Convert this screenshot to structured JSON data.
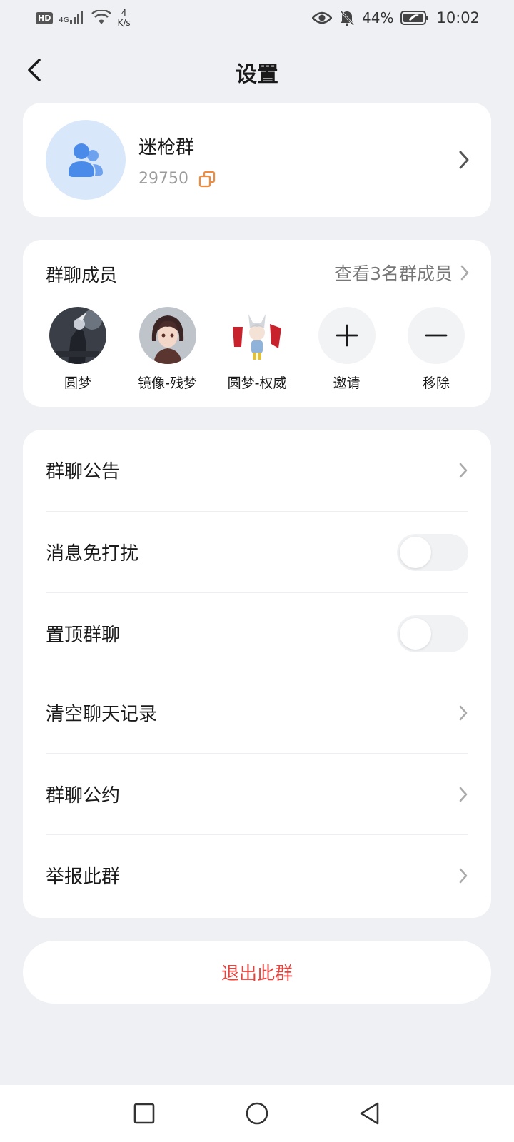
{
  "status_bar": {
    "hd_badge": "HD",
    "network": "4G",
    "speed_value": "4",
    "speed_unit": "K/s",
    "battery_percent": "44%",
    "time": "10:02"
  },
  "header": {
    "title": "设置"
  },
  "group": {
    "name": "迷枪群",
    "id": "29750"
  },
  "members": {
    "title": "群聊成员",
    "view_all": "查看3名群成员",
    "list": [
      {
        "label": "圆梦"
      },
      {
        "label": "镜像-残梦"
      },
      {
        "label": "圆梦-权威"
      }
    ],
    "invite_label": "邀请",
    "remove_label": "移除"
  },
  "settings": {
    "announcement": "群聊公告",
    "do_not_disturb": "消息免打扰",
    "pin_chat": "置顶群聊",
    "clear_history": "清空聊天记录",
    "group_rules": "群聊公约",
    "report_group": "举报此群",
    "do_not_disturb_on": false,
    "pin_chat_on": false
  },
  "exit_button": "退出此群",
  "colors": {
    "background": "#eef0f3",
    "accent_blue": "#4a8bea",
    "danger_red": "#e0463f",
    "copy_icon_orange": "#f08a3c"
  },
  "icons": [
    "back-icon",
    "group-icon",
    "copy-icon",
    "chevron-right-icon",
    "plus-icon",
    "minus-icon",
    "square-nav-icon",
    "circle-nav-icon",
    "triangle-back-nav-icon"
  ]
}
